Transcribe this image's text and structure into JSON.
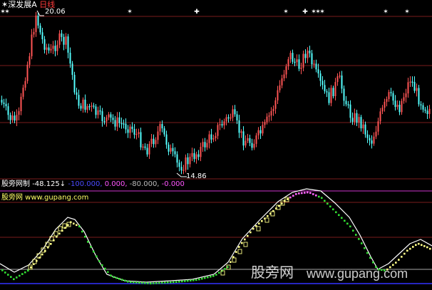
{
  "header": {
    "stock_name": "深发展A",
    "period": "日线",
    "title_color": "#ffffff",
    "period_color": "#ff3b3b"
  },
  "price_panel": {
    "high_label": "20.06",
    "low_label": "14.86",
    "star_marker": "✶",
    "plus_marker": "✚",
    "up_color": "#ff5555",
    "down_color": "#55ffff",
    "baseline_color": "#7a1c1c"
  },
  "indicator_header": {
    "name": "股旁网制",
    "current_value": "-48.125",
    "trend_arrow": "↓",
    "level_1": "-100.000,",
    "level_2": "0.000,",
    "level_3": "-80.000,",
    "level_4": "-0.000",
    "value_color": "#ffffff",
    "level_1_color": "#4a4aff",
    "level_2_color": "#ff55ff",
    "level_3_color": "#bbbbbb",
    "level_4_color": "#ff55ff"
  },
  "indicator_panel": {
    "site_label": "股旁网 www.gupang.com",
    "site_label_color": "#ffff66"
  },
  "watermark": {
    "cn": "股旁网",
    "url": "www.gupang.com"
  },
  "chart_data": {
    "type": "candlestick+line",
    "price": {
      "high": 20.06,
      "low": 14.86
    },
    "indicator": {
      "levels": [
        -100,
        0,
        -80,
        0
      ],
      "current": -48.125
    }
  }
}
